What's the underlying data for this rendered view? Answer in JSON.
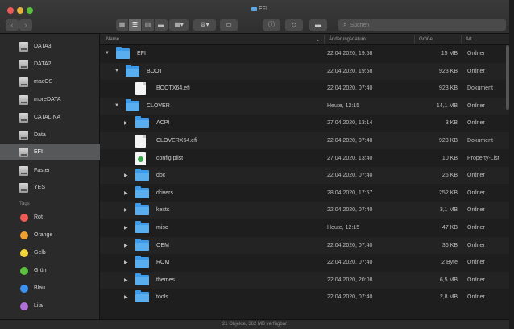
{
  "window": {
    "title": "EFI"
  },
  "toolbar": {
    "back_icon": "chevron-left-icon",
    "forward_icon": "chevron-right-icon",
    "search_placeholder": "Suchen"
  },
  "sidebar": {
    "devices": [
      {
        "label": "DATA3"
      },
      {
        "label": "DATA2"
      },
      {
        "label": "macOS"
      },
      {
        "label": "moreDATA"
      },
      {
        "label": "CATALINA"
      },
      {
        "label": "Data"
      },
      {
        "label": "EFI",
        "selected": true
      },
      {
        "label": "Faster"
      },
      {
        "label": "YES"
      }
    ],
    "tags_header": "Tags",
    "tags": [
      {
        "label": "Rot",
        "color": "#ee5b56"
      },
      {
        "label": "Orange",
        "color": "#f0a030"
      },
      {
        "label": "Gelb",
        "color": "#f2d33a"
      },
      {
        "label": "Grün",
        "color": "#5ac23c"
      },
      {
        "label": "Blau",
        "color": "#3d92ef"
      },
      {
        "label": "Lila",
        "color": "#b06fd9"
      }
    ]
  },
  "columns": {
    "name": "Name",
    "date": "Änderungsdatum",
    "size": "Größe",
    "kind": "Art"
  },
  "rows": [
    {
      "name": "EFI",
      "date": "22.04.2020, 19:58",
      "size": "15 MB",
      "kind": "Ordner",
      "type": "folder",
      "level": 0,
      "open": true
    },
    {
      "name": "BOOT",
      "date": "22.04.2020, 19:58",
      "size": "923 KB",
      "kind": "Ordner",
      "type": "folder",
      "level": 1,
      "open": true
    },
    {
      "name": "BOOTX64.efi",
      "date": "22.04.2020, 07:40",
      "size": "923 KB",
      "kind": "Dokument",
      "type": "doc",
      "level": 2
    },
    {
      "name": "CLOVER",
      "date": "Heute, 12:15",
      "size": "14,1 MB",
      "kind": "Ordner",
      "type": "folder",
      "level": 1,
      "open": true
    },
    {
      "name": "ACPI",
      "date": "27.04.2020, 13:14",
      "size": "3 KB",
      "kind": "Ordner",
      "type": "folder",
      "level": 2
    },
    {
      "name": "CLOVERX64.efi",
      "date": "22.04.2020, 07:40",
      "size": "923 KB",
      "kind": "Dokument",
      "type": "doc",
      "level": 2
    },
    {
      "name": "config.plist",
      "date": "27.04.2020, 13:40",
      "size": "10 KB",
      "kind": "Property-List",
      "type": "plist",
      "level": 2
    },
    {
      "name": "doc",
      "date": "22.04.2020, 07:40",
      "size": "25 KB",
      "kind": "Ordner",
      "type": "folder",
      "level": 2
    },
    {
      "name": "drivers",
      "date": "28.04.2020, 17:57",
      "size": "252 KB",
      "kind": "Ordner",
      "type": "folder",
      "level": 2
    },
    {
      "name": "kexts",
      "date": "22.04.2020, 07:40",
      "size": "3,1 MB",
      "kind": "Ordner",
      "type": "folder",
      "level": 2
    },
    {
      "name": "misc",
      "date": "Heute, 12:15",
      "size": "47 KB",
      "kind": "Ordner",
      "type": "folder",
      "level": 2
    },
    {
      "name": "OEM",
      "date": "22.04.2020, 07:40",
      "size": "36 KB",
      "kind": "Ordner",
      "type": "folder",
      "level": 2
    },
    {
      "name": "ROM",
      "date": "22.04.2020, 07:40",
      "size": "2 Byte",
      "kind": "Ordner",
      "type": "folder",
      "level": 2
    },
    {
      "name": "themes",
      "date": "22.04.2020, 20:08",
      "size": "6,5 MB",
      "kind": "Ordner",
      "type": "folder",
      "level": 2
    },
    {
      "name": "tools",
      "date": "22.04.2020, 07:40",
      "size": "2,8 MB",
      "kind": "Ordner",
      "type": "folder",
      "level": 2
    }
  ],
  "status": {
    "text": "21 Objekte, 362 MB verfügbar"
  }
}
